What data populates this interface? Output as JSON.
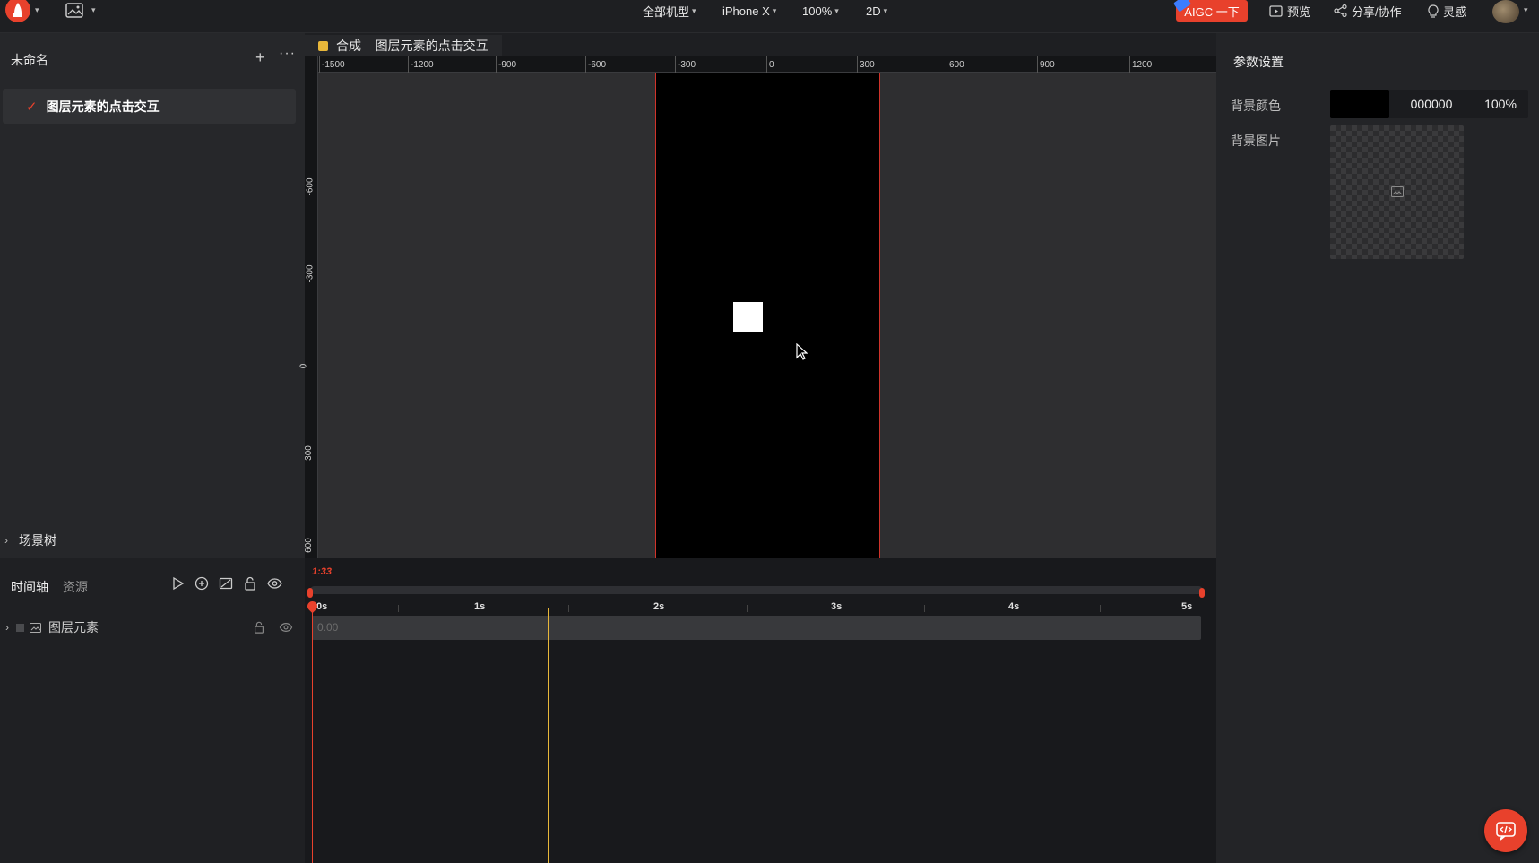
{
  "topbar": {
    "device_group": "全部机型",
    "device": "iPhone X",
    "zoom": "100%",
    "mode": "2D",
    "aigc_label": "AIGC 一下",
    "preview_label": "预览",
    "share_label": "分享/协作",
    "inspiration_label": "灵感"
  },
  "left": {
    "project_title": "未命名",
    "scene_item": "图层元素的点击交互",
    "scene_tree_label": "场景树"
  },
  "canvas": {
    "tab_label": "合成 – 图层元素的点击交互",
    "ruler_top": [
      "-1500",
      "-1200",
      "-900",
      "-600",
      "-300",
      "0",
      "300",
      "600",
      "900",
      "1200"
    ],
    "ruler_left": [
      "-600",
      "-300",
      "0",
      "300",
      "600"
    ]
  },
  "right": {
    "title": "参数设置",
    "bg_color_label": "背景颜色",
    "bg_color_hex": "000000",
    "bg_color_opacity": "100%",
    "bg_image_label": "背景图片",
    "bg_color": "#000000"
  },
  "timeline": {
    "tab_timeline": "时间轴",
    "tab_assets": "资源",
    "timecode": "1:33",
    "seconds": [
      "0s",
      "1s",
      "2s",
      "3s",
      "4s",
      "5s"
    ],
    "layer_name": "图层元素",
    "track_value": "0.00"
  },
  "colors": {
    "accent": "#e8412c",
    "playhead": "#e8b73a"
  }
}
